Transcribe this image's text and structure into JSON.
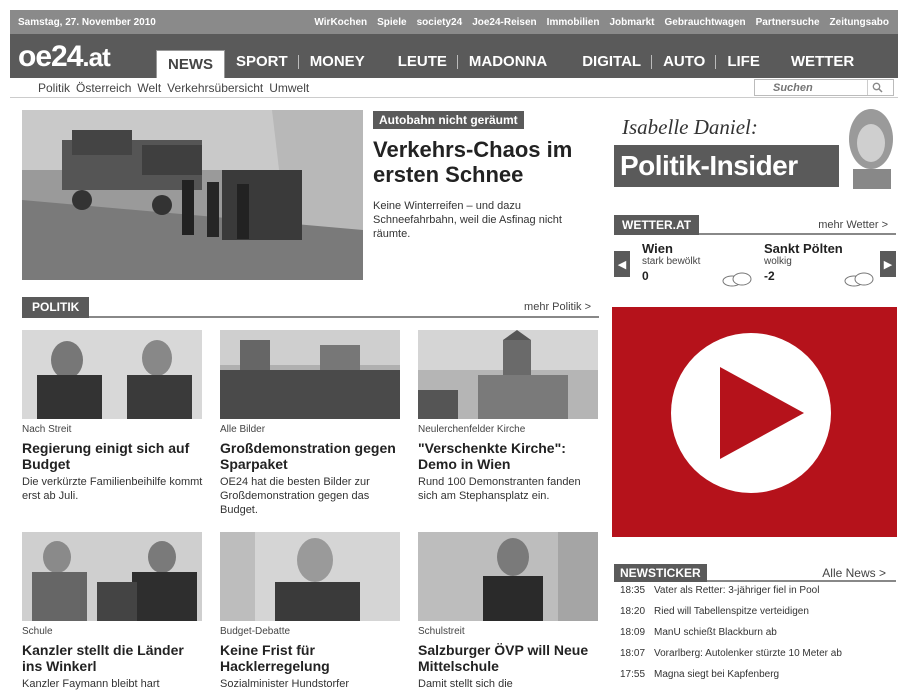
{
  "topbar": {
    "date": "Samstag, 27. November 2010",
    "links": [
      "WirKochen",
      "Spiele",
      "society24",
      "Joe24-Reisen",
      "Immobilien",
      "Jobmarkt",
      "Gebrauchtwagen",
      "Partnersuche",
      "Zeitungsabo"
    ]
  },
  "logo": {
    "main": "oe24",
    "suffix": ".at"
  },
  "nav": {
    "items": [
      "NEWS",
      "SPORT",
      "MONEY",
      "LEUTE",
      "MADONNA",
      "DIGITAL",
      "AUTO",
      "LIFE",
      "WETTER"
    ],
    "active": "NEWS"
  },
  "subnav": {
    "links": [
      "Politik",
      "Österreich",
      "Welt",
      "Verkehrsübersicht",
      "Umwelt"
    ],
    "search_placeholder": "Suchen"
  },
  "hero": {
    "tag": "Autobahn nicht geräumt",
    "title": "Verkehrs-Chaos im ersten Schnee",
    "teaser": "Keine Winterreifen – und dazu Schneefahrbahn, weil die Asfinag nicht räumte."
  },
  "politik": {
    "label": "POLITIK",
    "more": "mehr Politik >",
    "articles": [
      {
        "kicker": "Nach Streit",
        "title": "Regierung einigt sich auf Budget",
        "teaser": "Die verkürzte Familienbeihilfe kommt erst ab Juli."
      },
      {
        "kicker": "Alle Bilder",
        "title": "Großdemonstration gegen Sparpaket",
        "teaser": "OE24 hat die besten Bilder zur Großdemonstration gegen das Budget."
      },
      {
        "kicker": "Neulerchenfelder Kirche",
        "title": "\"Verschenkte Kirche\": Demo in Wien",
        "teaser": "Rund 100 Demonstranten fanden sich am Stephansplatz ein."
      },
      {
        "kicker": "Schule",
        "title": "Kanzler stellt die Länder ins Winkerl",
        "teaser": "Kanzler Faymann bleibt hart"
      },
      {
        "kicker": "Budget-Debatte",
        "title": "Keine Frist für Hacklerregelung",
        "teaser": "Sozialminister Hundstorfer"
      },
      {
        "kicker": "Schulstreit",
        "title": "Salzburger ÖVP will Neue Mittelschule",
        "teaser": "Damit stellt sich die"
      }
    ]
  },
  "insider": {
    "name": "Isabelle Daniel:",
    "title": "Politik-Insider"
  },
  "weather": {
    "label": "WETTER.AT",
    "more": "mehr Wetter >",
    "cities": [
      {
        "city": "Wien",
        "desc": "stark bewölkt",
        "temp": "0"
      },
      {
        "city": "Sankt Pölten",
        "desc": "wolkig",
        "temp": "-2"
      }
    ]
  },
  "ticker": {
    "label": "NEWSTICKER",
    "more": "Alle News >",
    "items": [
      {
        "time": "18:35",
        "text": "Vater als Retter: 3-jähriger fiel in Pool"
      },
      {
        "time": "18:20",
        "text": "Ried will Tabellenspitze verteidigen"
      },
      {
        "time": "18:09",
        "text": "ManU schießt Blackburn ab"
      },
      {
        "time": "18:07",
        "text": "Vorarlberg: Autolenker stürzte 10 Meter ab"
      },
      {
        "time": "17:55",
        "text": "Magna siegt bei Kapfenberg"
      }
    ]
  },
  "colors": {
    "bar": "#5a5a5a",
    "topbar": "#8a8a8a",
    "video_red": "#b5121b"
  }
}
